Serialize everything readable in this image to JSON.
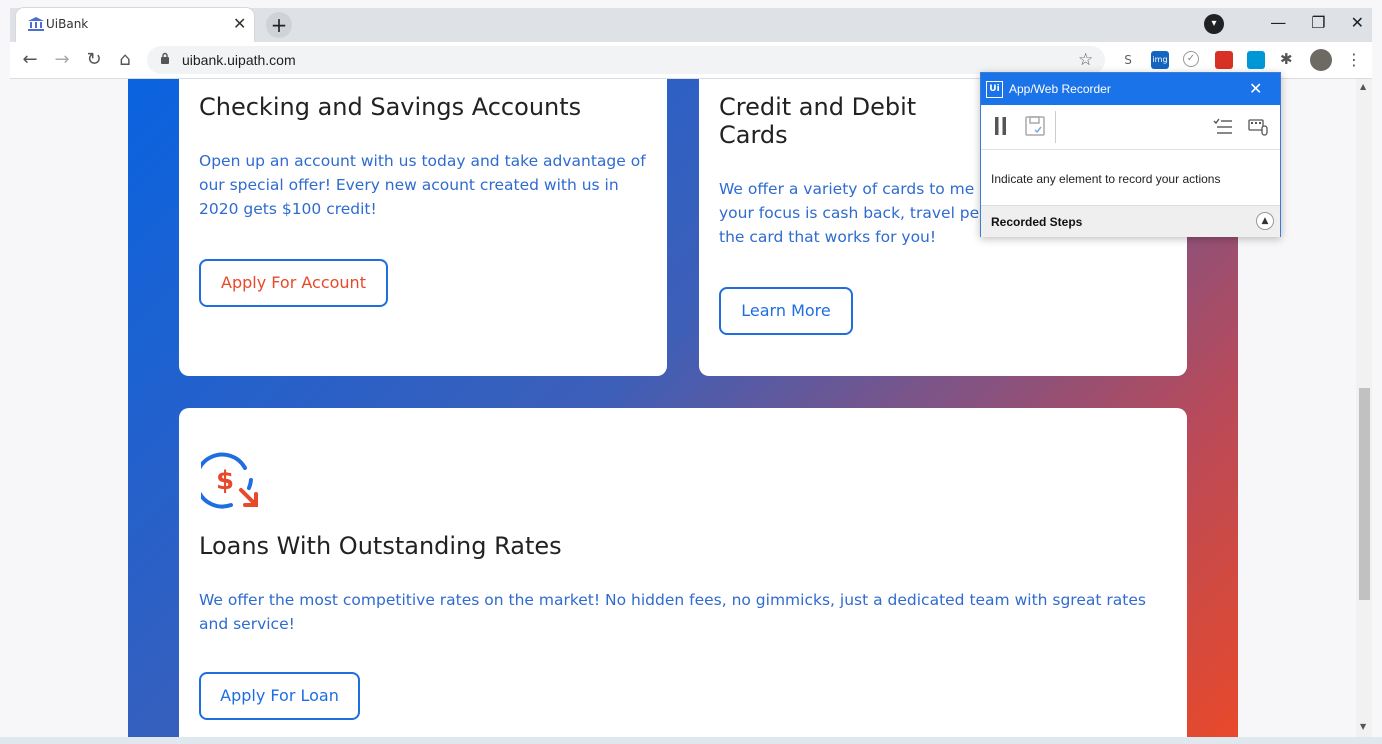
{
  "browser": {
    "tab_title": "UiBank",
    "tab_close": "✕",
    "new_tab": "+",
    "url": "uibank.uipath.com",
    "window_controls": [
      "—",
      "❐",
      "✕"
    ],
    "extensions": [
      {
        "name": "s-extension-icon",
        "text": "S",
        "color": "#5f6368"
      },
      {
        "name": "img-extension-icon",
        "text": "img",
        "color": "#1565c0"
      },
      {
        "name": "checkmark-extension-icon",
        "text": "✓",
        "color": "#888888"
      },
      {
        "name": "red-extension-icon",
        "text": "",
        "color": "#d93025"
      },
      {
        "name": "uipath-extension-icon",
        "text": "",
        "color": "#0097d7"
      }
    ]
  },
  "cards": {
    "checking": {
      "title": "Checking and Savings Accounts",
      "text": "Open up an account with us today and take advantage of our special offer! Every new acount created with us in 2020 gets $100 credit!",
      "button": "Apply For Account"
    },
    "credit": {
      "title_line1": "Credit and Debit",
      "title_line2": "Cards",
      "text_line1": "We offer a variety of cards to me",
      "text_line2": "your focus is cash back, travel pe",
      "text_line3": "the card that works for you!",
      "button": "Learn More"
    },
    "loans": {
      "title": "Loans With Outstanding Rates",
      "text": "We offer the most competitive rates on the market! No hidden fees, no gimmicks, just a dedicated team with sgreat rates and service!",
      "button": "Apply For Loan"
    }
  },
  "colors": {
    "accent": "#1e6ee0",
    "apply_account_text": "#e8492a",
    "loan_icon_blue": "#1e6ee0",
    "loan_icon_orange": "#e8492a"
  },
  "recorder": {
    "logo": "Ui",
    "title": "App/Web Recorder",
    "message": "Indicate any element to record your actions",
    "steps_label": "Recorded Steps"
  }
}
